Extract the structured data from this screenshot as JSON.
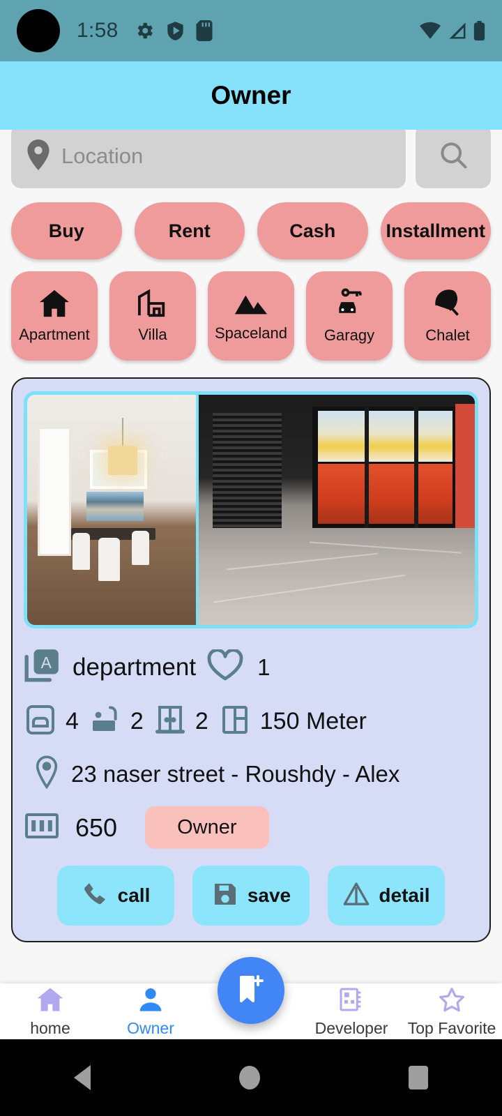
{
  "statusbar": {
    "time": "1:58",
    "icons_left": [
      "gear-icon",
      "play-protect-icon",
      "sd-card-icon"
    ],
    "icons_right": [
      "wifi-icon",
      "cellular-signal-icon",
      "battery-icon"
    ],
    "background": "#5EA3AF"
  },
  "appbar": {
    "title": "Owner",
    "background": "#86E2FB"
  },
  "search": {
    "placeholder": "Location",
    "value": "",
    "pin_icon": "location-pin-icon",
    "search_icon": "search-icon"
  },
  "filters": [
    {
      "label": "Buy"
    },
    {
      "label": "Rent"
    },
    {
      "label": "Cash"
    },
    {
      "label": "Installment"
    }
  ],
  "categories": [
    {
      "label": "Apartment",
      "icon": "house-icon"
    },
    {
      "label": "Villa",
      "icon": "villa-building-icon"
    },
    {
      "label": "Spaceland",
      "icon": "mountains-icon"
    },
    {
      "label": "Garagy",
      "icon": "car-key-icon"
    },
    {
      "label": "Chalet",
      "icon": "beach-umbrella-icon"
    }
  ],
  "listing": {
    "type_badge_letter": "A",
    "title": "department",
    "favorites_count": "1",
    "specs": [
      {
        "icon": "bed-icon",
        "value": "4"
      },
      {
        "icon": "bathtub-icon",
        "value": "2"
      },
      {
        "icon": "door-icon",
        "value": "2"
      },
      {
        "icon": "area-icon",
        "value": "150 Meter"
      }
    ],
    "address": "23 naser street - Roushdy  - Alex",
    "price": "650",
    "price_icon": "banknote-icon",
    "seller_badge": "Owner",
    "actions": [
      {
        "label": "call",
        "icon": "phone-icon"
      },
      {
        "label": "save",
        "icon": "floppy-disk-icon"
      },
      {
        "label": "detail",
        "icon": "triangle-detail-icon"
      }
    ],
    "photos": [
      {
        "alt": "dining room with chandelier and wooden floor"
      },
      {
        "alt": "empty loft room with large windows"
      }
    ]
  },
  "bottom_nav": {
    "items": [
      {
        "label": "home",
        "icon": "home-icon",
        "active": false
      },
      {
        "label": "Owner",
        "icon": "person-icon",
        "active": true
      },
      {
        "label": "Developer",
        "icon": "developer-book-icon",
        "active": false
      },
      {
        "label": "Top Favorite",
        "icon": "star-icon",
        "active": false
      }
    ],
    "fab_icon": "bookmark-add-icon",
    "active_color": "#2F8AF6"
  },
  "android_nav": {
    "back": "back-button",
    "home": "home-button",
    "recents": "recents-button"
  },
  "colors": {
    "pink": "#F09B9B",
    "badge_pink": "#FAC0BC",
    "cyan": "#8DE5FB",
    "card_bg": "#D7DCF6",
    "teal_icon": "#5A7E8A"
  }
}
